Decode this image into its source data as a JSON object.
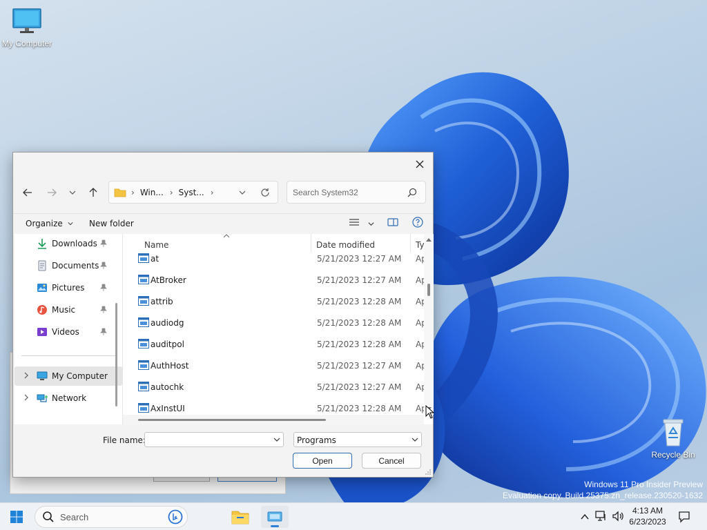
{
  "desktop": {
    "icons": {
      "my_computer": "My Computer",
      "recycle_bin": "Recycle Bin"
    },
    "watermark": {
      "line1": "Windows 11 Pro Insider Preview",
      "line2": "Evaluation copy. Build 25375.zn_release.230520-1632"
    }
  },
  "dialog": {
    "address": {
      "segments": [
        "Win...",
        "Syst..."
      ]
    },
    "search_placeholder": "Search System32",
    "commands": {
      "organize": "Organize",
      "new_folder": "New folder"
    },
    "nav_pane": {
      "quick_access": [
        {
          "label": "Downloads",
          "icon": "download-icon"
        },
        {
          "label": "Documents",
          "icon": "document-icon"
        },
        {
          "label": "Pictures",
          "icon": "pictures-icon"
        },
        {
          "label": "Music",
          "icon": "music-icon"
        },
        {
          "label": "Videos",
          "icon": "videos-icon"
        }
      ],
      "tree": [
        {
          "label": "My Computer",
          "icon": "computer-icon",
          "selected": true
        },
        {
          "label": "Network",
          "icon": "network-icon",
          "selected": false
        }
      ]
    },
    "columns": {
      "name": "Name",
      "date": "Date modified",
      "type": "Ty"
    },
    "files": [
      {
        "name": "at",
        "date": "5/21/2023 12:27 AM",
        "type": "Ap"
      },
      {
        "name": "AtBroker",
        "date": "5/21/2023 12:27 AM",
        "type": "Ap"
      },
      {
        "name": "attrib",
        "date": "5/21/2023 12:28 AM",
        "type": "Ap"
      },
      {
        "name": "audiodg",
        "date": "5/21/2023 12:28 AM",
        "type": "Ap"
      },
      {
        "name": "auditpol",
        "date": "5/21/2023 12:28 AM",
        "type": "Ap"
      },
      {
        "name": "AuthHost",
        "date": "5/21/2023 12:27 AM",
        "type": "Ap"
      },
      {
        "name": "autochk",
        "date": "5/21/2023 12:27 AM",
        "type": "Ap"
      },
      {
        "name": "AxInstUI",
        "date": "5/21/2023 12:28 AM",
        "type": "Ap"
      }
    ],
    "file_name_label": "File name:",
    "file_name_value": "",
    "file_type": "Programs",
    "open_label": "Open",
    "cancel_label": "Cancel"
  },
  "taskbar": {
    "search_placeholder": "Search",
    "time": "4:13 AM",
    "date": "6/23/2023"
  },
  "colors": {
    "accent": "#2d7fd6",
    "folder": "#f4c542",
    "wallpaper_blue": "#1f5fd6"
  }
}
